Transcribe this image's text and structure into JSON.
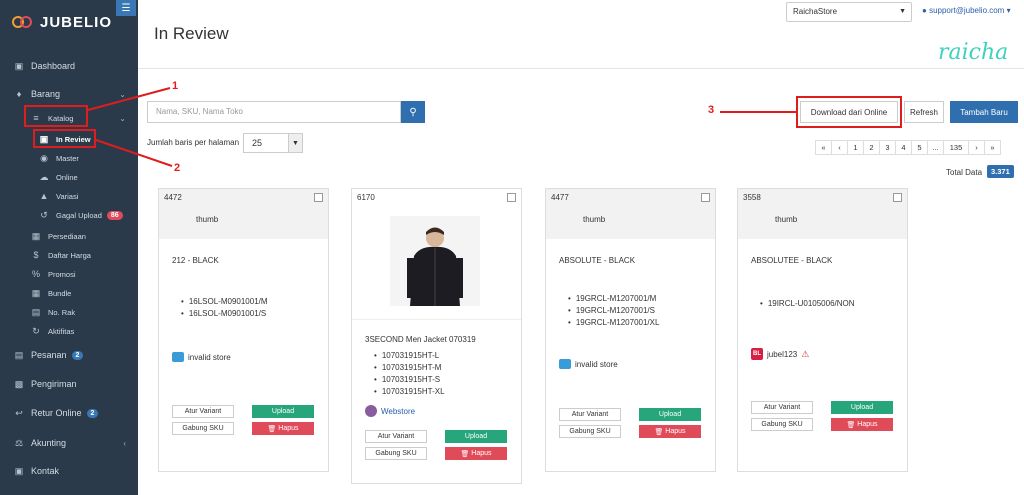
{
  "app": {
    "name": "JUBELIO",
    "brand_script": "raicha"
  },
  "sidebar": {
    "items": [
      {
        "label": "Dashboard"
      },
      {
        "label": "Barang"
      },
      {
        "label": "Katalog"
      },
      {
        "label": "In Review"
      },
      {
        "label": "Master"
      },
      {
        "label": "Online"
      },
      {
        "label": "Variasi"
      },
      {
        "label": "Gagal Upload",
        "badge": "86"
      },
      {
        "label": "Persediaan"
      },
      {
        "label": "Daftar Harga"
      },
      {
        "label": "Promosi"
      },
      {
        "label": "Bundle"
      },
      {
        "label": "No. Rak"
      },
      {
        "label": "Aktifitas"
      },
      {
        "label": "Pesanan",
        "badge": "2"
      },
      {
        "label": "Pengiriman"
      },
      {
        "label": "Retur Online",
        "badge": "2"
      },
      {
        "label": "Akunting"
      },
      {
        "label": "Kontak"
      }
    ]
  },
  "annotations": {
    "n1": "1",
    "n2": "2",
    "n3": "3"
  },
  "header": {
    "title": "In Review",
    "store": "RaichaStore",
    "email": "support@jubelio.com"
  },
  "toolbar": {
    "search_placeholder": "Nama, SKU, Nama Toko",
    "download_label": "Download dari Online",
    "refresh_label": "Refresh",
    "add_label": "Tambah Baru",
    "perpage_label": "Jumlah baris per halaman",
    "perpage_value": "25"
  },
  "pagination": {
    "first": "«",
    "prev": "‹",
    "p1": "1",
    "p2": "2",
    "p3": "3",
    "p4": "4",
    "p5": "5",
    "ellipsis": "...",
    "last_page": "135",
    "next": "›",
    "last": "»"
  },
  "total": {
    "label": "Total Data",
    "value": "3.371"
  },
  "cards": [
    {
      "id": "4472",
      "thumb": "thumb",
      "name": "212 - BLACK",
      "skus": [
        "16LSOL-M0901001/M",
        "16LSOL-M0901001/S"
      ],
      "store": "invalid store",
      "variant_label": "Atur Variant",
      "upload_label": "Upload",
      "gabung_label": "Gabung SKU",
      "hapus_label": "Hapus"
    },
    {
      "id": "6170",
      "name": "3SECOND Men Jacket 070319",
      "skus": [
        "107031915HT-L",
        "107031915HT-M",
        "107031915HT-S",
        "107031915HT-XL"
      ],
      "store": "Webstore",
      "variant_label": "Atur Variant",
      "upload_label": "Upload",
      "gabung_label": "Gabung SKU",
      "hapus_label": "Hapus"
    },
    {
      "id": "4477",
      "thumb": "thumb",
      "name": "ABSOLUTE - BLACK",
      "skus": [
        "19GRCL-M1207001/M",
        "19GRCL-M1207001/S",
        "19GRCL-M1207001/XL"
      ],
      "store": "invalid store",
      "variant_label": "Atur Variant",
      "upload_label": "Upload",
      "gabung_label": "Gabung SKU",
      "hapus_label": "Hapus"
    },
    {
      "id": "3558",
      "thumb": "thumb",
      "name": "ABSOLUTEE - BLACK",
      "skus": [
        "19IRCL-U0105006/NON"
      ],
      "store": "jubel123",
      "store_icon_text": "BL",
      "variant_label": "Atur Variant",
      "upload_label": "Upload",
      "gabung_label": "Gabung SKU",
      "hapus_label": "Hapus"
    }
  ],
  "colors": {
    "sidebar_bg": "#2b3a4a",
    "primary": "#2f6eaf",
    "success": "#26a67a",
    "danger": "#e04b5a",
    "annotation": "#e01d1d"
  }
}
